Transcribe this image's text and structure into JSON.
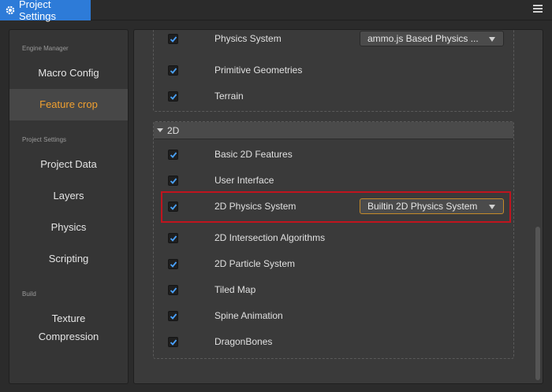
{
  "window": {
    "title": "Project Settings",
    "tab_icon": "gear-icon",
    "menu_icon": "hamburger-menu-icon",
    "accent": "#2d7bd8"
  },
  "sidebar": {
    "engine_manager_label": "Engine Manager",
    "macro_config": "Macro Config",
    "feature_crop": "Feature crop",
    "project_settings_label": "Project Settings",
    "project_data": "Project Data",
    "layers": "Layers",
    "physics": "Physics",
    "scripting": "Scripting",
    "build_label": "Build",
    "texture_compression_line1": "Texture",
    "texture_compression_line2": "Compression",
    "active_color": "#f0a030"
  },
  "features": {
    "top_items": [
      {
        "label": "Physics System",
        "checked": true,
        "dropdown": "ammo.js Based Physics ..."
      },
      {
        "label": "Primitive Geometries",
        "checked": true
      },
      {
        "label": "Terrain",
        "checked": true
      }
    ],
    "group_2d": {
      "title": "2D",
      "items": [
        {
          "label": "Basic 2D Features",
          "checked": true
        },
        {
          "label": "User Interface",
          "checked": true
        },
        {
          "label": "2D Physics System",
          "checked": true,
          "dropdown": "Builtin 2D Physics System"
        },
        {
          "label": "2D Intersection Algorithms",
          "checked": true
        },
        {
          "label": "2D Particle System",
          "checked": true
        },
        {
          "label": "Tiled Map",
          "checked": true
        },
        {
          "label": "Spine Animation",
          "checked": true
        },
        {
          "label": "DragonBones",
          "checked": true
        }
      ]
    },
    "highlight_color": "#c0141e",
    "checkmark_color": "#4aa3ff"
  }
}
